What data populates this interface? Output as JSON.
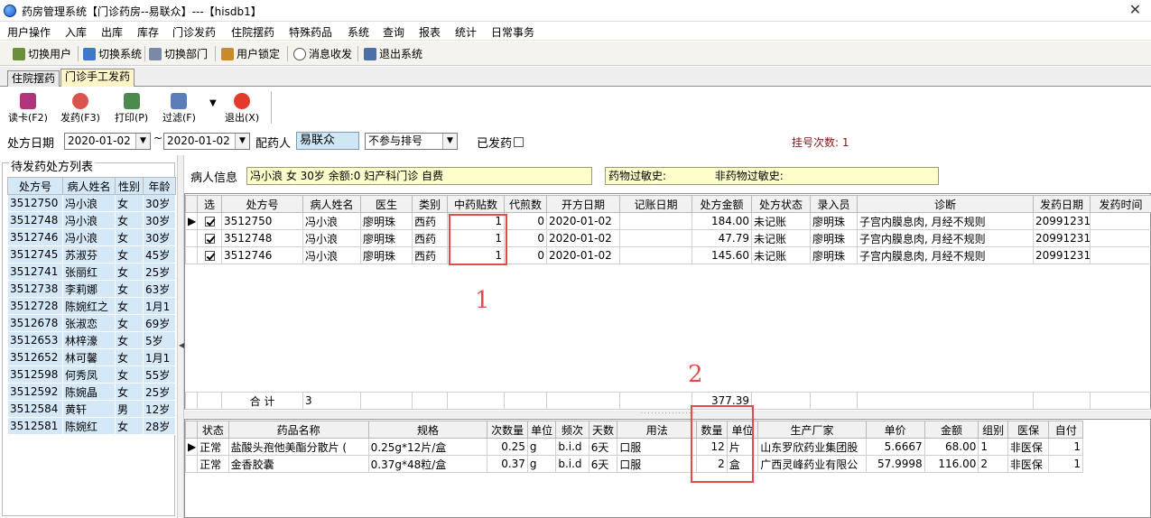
{
  "window": {
    "title": "药房管理系统【门诊药房--易联众】---【hisdb1】",
    "close_glyph": "✕"
  },
  "menu": [
    "用户操作",
    "入库",
    "出库",
    "库存",
    "门诊发药",
    "住院摆药",
    "特殊药品",
    "系统",
    "查询",
    "报表",
    "统计",
    "日常事务"
  ],
  "toolbar": [
    "切换用户",
    "切换系统",
    "切换部门",
    "用户锁定",
    "消息收发",
    "退出系统"
  ],
  "tabs": [
    "住院摆药",
    "门诊手工发药"
  ],
  "actions": {
    "read_card": "读卡(F2)",
    "dispense": "发药(F3)",
    "print": "打印(P)",
    "filter": "过滤(F)",
    "exit": "退出(X)"
  },
  "filters": {
    "date_label": "处方日期",
    "date_from": "2020-01-02",
    "tilde": "~",
    "date_to": "2020-01-02",
    "pharmacist_label": "配药人",
    "pharmacist": "易联众",
    "queue_option": "不参与排号",
    "dispensed_label": "已发药",
    "reg_count": "挂号次数: 1"
  },
  "left": {
    "title": "待发药处方列表",
    "columns": [
      "处方号",
      "病人姓名",
      "性别",
      "年龄"
    ],
    "rows": [
      [
        "3512750",
        "冯小浪",
        "女",
        "30岁"
      ],
      [
        "3512748",
        "冯小浪",
        "女",
        "30岁"
      ],
      [
        "3512746",
        "冯小浪",
        "女",
        "30岁"
      ],
      [
        "3512745",
        "苏淑芬",
        "女",
        "45岁"
      ],
      [
        "3512741",
        "张丽红",
        "女",
        "25岁"
      ],
      [
        "3512738",
        "李莉娜",
        "女",
        "63岁"
      ],
      [
        "3512728",
        "陈婉红之",
        "女",
        "1月1"
      ],
      [
        "3512678",
        "张淑恋",
        "女",
        "69岁"
      ],
      [
        "3512653",
        "林梓濠",
        "女",
        "5岁"
      ],
      [
        "3512652",
        "林可馨",
        "女",
        "1月1"
      ],
      [
        "3512598",
        "何秀凤",
        "女",
        "55岁"
      ],
      [
        "3512592",
        "陈婉晶",
        "女",
        "25岁"
      ],
      [
        "3512584",
        "黄轩",
        "男",
        "12岁"
      ],
      [
        "3512581",
        "陈婉红",
        "女",
        "28岁"
      ]
    ]
  },
  "patient": {
    "label": "病人信息",
    "info": "冯小浪  女 30岁 余额:0 妇产科门诊 自费",
    "allergy": "药物过敏史:",
    "non_allergy": "非药物过敏史:"
  },
  "rx": {
    "columns": [
      "选",
      "处方号",
      "病人姓名",
      "医生",
      "类别",
      "中药贴数",
      "代煎数",
      "开方日期",
      "记账日期",
      "处方金额",
      "处方状态",
      "录入员",
      "诊断",
      "发药日期",
      "发药时间"
    ],
    "rows": [
      {
        "no": "3512750",
        "name": "冯小浪",
        "doctor": "廖明珠",
        "type": "西药",
        "tie": "1",
        "decoct": "0",
        "date": "2020-01-02",
        "amount": "184.00",
        "status": "未记账",
        "clerk": "廖明珠",
        "diag": "子宫内膜息肉, 月经不规则",
        "disp_date": "20991231"
      },
      {
        "no": "3512748",
        "name": "冯小浪",
        "doctor": "廖明珠",
        "type": "西药",
        "tie": "1",
        "decoct": "0",
        "date": "2020-01-02",
        "amount": "47.79",
        "status": "未记账",
        "clerk": "廖明珠",
        "diag": "子宫内膜息肉, 月经不规则",
        "disp_date": "20991231"
      },
      {
        "no": "3512746",
        "name": "冯小浪",
        "doctor": "廖明珠",
        "type": "西药",
        "tie": "1",
        "decoct": "0",
        "date": "2020-01-02",
        "amount": "145.60",
        "status": "未记账",
        "clerk": "廖明珠",
        "diag": "子宫内膜息肉, 月经不规则",
        "disp_date": "20991231"
      }
    ],
    "total_label": "合  计",
    "total_count": "3",
    "total_amount": "377.39"
  },
  "drug": {
    "columns": [
      "状态",
      "药品名称",
      "规格",
      "次数量",
      "单位",
      "频次",
      "天数",
      "用法",
      "数量",
      "单位",
      "生产厂家",
      "单价",
      "金额",
      "组别",
      "医保",
      "自付"
    ],
    "rows": [
      [
        "正常",
        "盐酸头孢他美酯分散片 (",
        "0.25g*12片/盒",
        "0.25",
        "g",
        "b.i.d",
        "6天",
        "口服",
        "12",
        "片",
        "山东罗欣药业集团股",
        "5.6667",
        "68.00",
        "1",
        "非医保",
        "1"
      ],
      [
        "正常",
        "金香胶囊",
        "0.37g*48粒/盒",
        "0.37",
        "g",
        "b.i.d",
        "6天",
        "口服",
        "2",
        "盒",
        "广西灵峰药业有限公",
        "57.9998",
        "116.00",
        "2",
        "非医保",
        "1"
      ]
    ]
  },
  "annotations": {
    "mark1": "1",
    "mark2": "2"
  }
}
